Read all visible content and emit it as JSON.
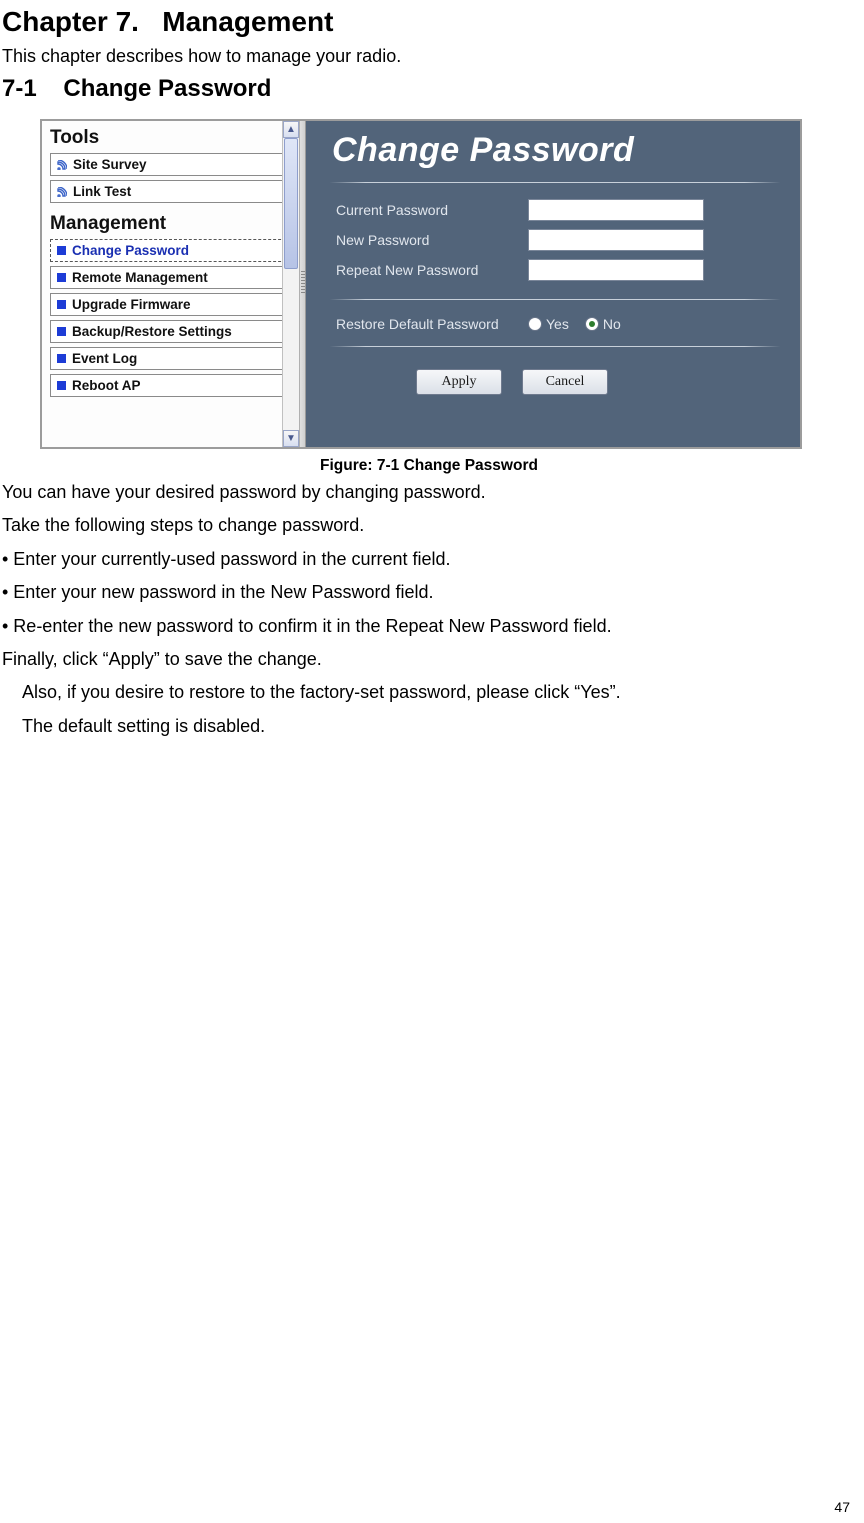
{
  "chapter_title": "Chapter 7.   Management",
  "intro": "This chapter describes how to manage your radio.",
  "section_title": "7-1    Change Password",
  "sidebar": {
    "tools_heading": "Tools",
    "tools_items": [
      "Site Survey",
      "Link Test"
    ],
    "mgmt_heading": "Management",
    "mgmt_items": [
      "Change Password",
      "Remote Management",
      "Upgrade Firmware",
      "Backup/Restore Settings",
      "Event Log",
      "Reboot AP"
    ],
    "active_item": "Change Password"
  },
  "panel": {
    "header": "Change Password",
    "labels": {
      "current": "Current Password",
      "new": "New Password",
      "repeat": "Repeat New Password",
      "restore": "Restore Default Password"
    },
    "radio_yes": "Yes",
    "radio_no": "No",
    "radio_selected": "No",
    "apply": "Apply",
    "cancel": "Cancel"
  },
  "caption": "Figure: 7-1 Change Password",
  "body": {
    "p1": "You can have your desired password by changing password.",
    "p2": "Take the following steps to change password.",
    "p3": "• Enter your currently-used password in the current field.",
    "p4": "• Enter your new password in the New Password field.",
    "p5": "• Re-enter the new password to confirm it in the Repeat New Password field.",
    "p6": "Finally, click “Apply” to save the change.",
    "p7": "Also, if you desire to restore to the factory-set password, please click “Yes”.",
    "p8": "The default setting is disabled."
  },
  "page_number": "47"
}
